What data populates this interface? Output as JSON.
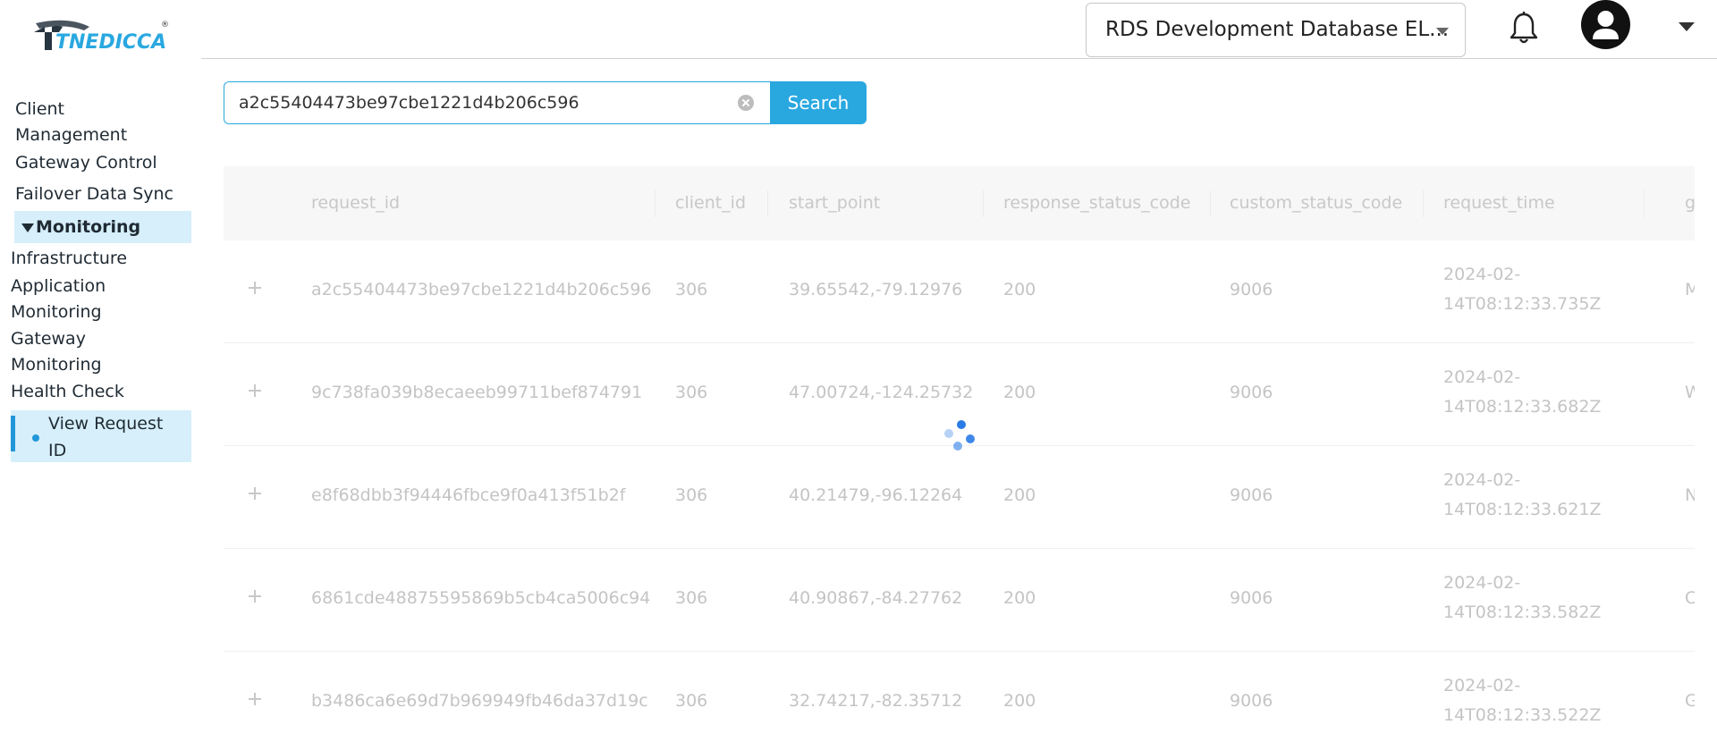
{
  "brand": {
    "logo_text": "TNEDICCA",
    "registered_mark": "®"
  },
  "sidebar": {
    "items": [
      {
        "label": "Client Management"
      },
      {
        "label": "Gateway Control"
      },
      {
        "label": "Failover Data Sync"
      }
    ],
    "group": {
      "label": "Monitoring",
      "expanded": true
    },
    "sub_items": [
      {
        "label": "Infrastructure"
      },
      {
        "label": "Application Monitoring"
      },
      {
        "label": "Gateway Monitoring"
      },
      {
        "label": "Health Check"
      }
    ],
    "active_item": {
      "label": "View Request ID"
    }
  },
  "header": {
    "database_select": "RDS Development Database EL...",
    "bell_icon": "bell-icon",
    "avatar_icon": "user-avatar-icon",
    "menu_icon": "caret-down-icon"
  },
  "search": {
    "value": "a2c55404473be97cbe1221d4b206c596",
    "button_label": "Search"
  },
  "table": {
    "columns": [
      "request_id",
      "client_id",
      "start_point",
      "response_status_code",
      "custom_status_code",
      "request_time",
      "g"
    ],
    "rows": [
      {
        "request_id": "a2c55404473be97cbe1221d4b206c596",
        "client_id": "306",
        "start_point": "39.65542,-79.12976",
        "response_status_code": "200",
        "custom_status_code": "9006",
        "request_time": "2024-02-14T08:12:33.735Z",
        "extra": "M"
      },
      {
        "request_id": "9c738fa039b8ecaeeb99711bef874791",
        "client_id": "306",
        "start_point": "47.00724,-124.25732",
        "response_status_code": "200",
        "custom_status_code": "9006",
        "request_time": "2024-02-14T08:12:33.682Z",
        "extra": "W"
      },
      {
        "request_id": "e8f68dbb3f94446fbce9f0a413f51b2f",
        "client_id": "306",
        "start_point": "40.21479,-96.12264",
        "response_status_code": "200",
        "custom_status_code": "9006",
        "request_time": "2024-02-14T08:12:33.621Z",
        "extra": "N"
      },
      {
        "request_id": "6861cde48875595869b5cb4ca5006c94",
        "client_id": "306",
        "start_point": "40.90867,-84.27762",
        "response_status_code": "200",
        "custom_status_code": "9006",
        "request_time": "2024-02-14T08:12:33.582Z",
        "extra": "C"
      },
      {
        "request_id": "b3486ca6e69d7b969949fb46da37d19c",
        "client_id": "306",
        "start_point": "32.74217,-82.35712",
        "response_status_code": "200",
        "custom_status_code": "9006",
        "request_time": "2024-02-14T08:12:33.522Z",
        "extra": "G"
      }
    ]
  },
  "loading": true
}
